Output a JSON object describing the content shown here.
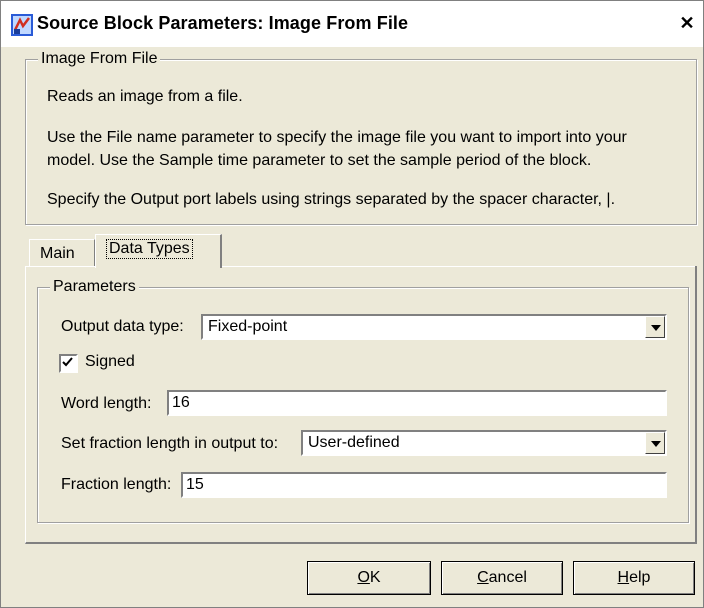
{
  "window": {
    "title": "Source Block Parameters: Image From File",
    "close_label": "✕"
  },
  "block_group": {
    "legend": "Image From File",
    "line1": "Reads an image from a file.",
    "line2": "Use the File name parameter to specify the image file you want to import into your",
    "line3": "model. Use the Sample time parameter to set the sample period of the block.",
    "line4": "Specify the Output port labels using strings separated by the spacer character, |."
  },
  "tabs": [
    {
      "label": "Main",
      "selected": false
    },
    {
      "label": "Data Types",
      "selected": true
    }
  ],
  "params": {
    "legend": "Parameters",
    "output_data_type": {
      "label": "Output data type:",
      "value": "Fixed-point"
    },
    "signed": {
      "label": "Signed",
      "checked": true
    },
    "word_length": {
      "label": "Word length:",
      "value": "16"
    },
    "fraction_mode": {
      "label": "Set fraction length in output to:",
      "value": "User-defined"
    },
    "fraction_length": {
      "label": "Fraction length:",
      "value": "15"
    }
  },
  "buttons": {
    "ok": {
      "mnemonic": "O",
      "rest": "K"
    },
    "cancel": {
      "mnemonic": "C",
      "rest": "ancel"
    },
    "help": {
      "mnemonic": "H",
      "rest": "elp"
    }
  }
}
